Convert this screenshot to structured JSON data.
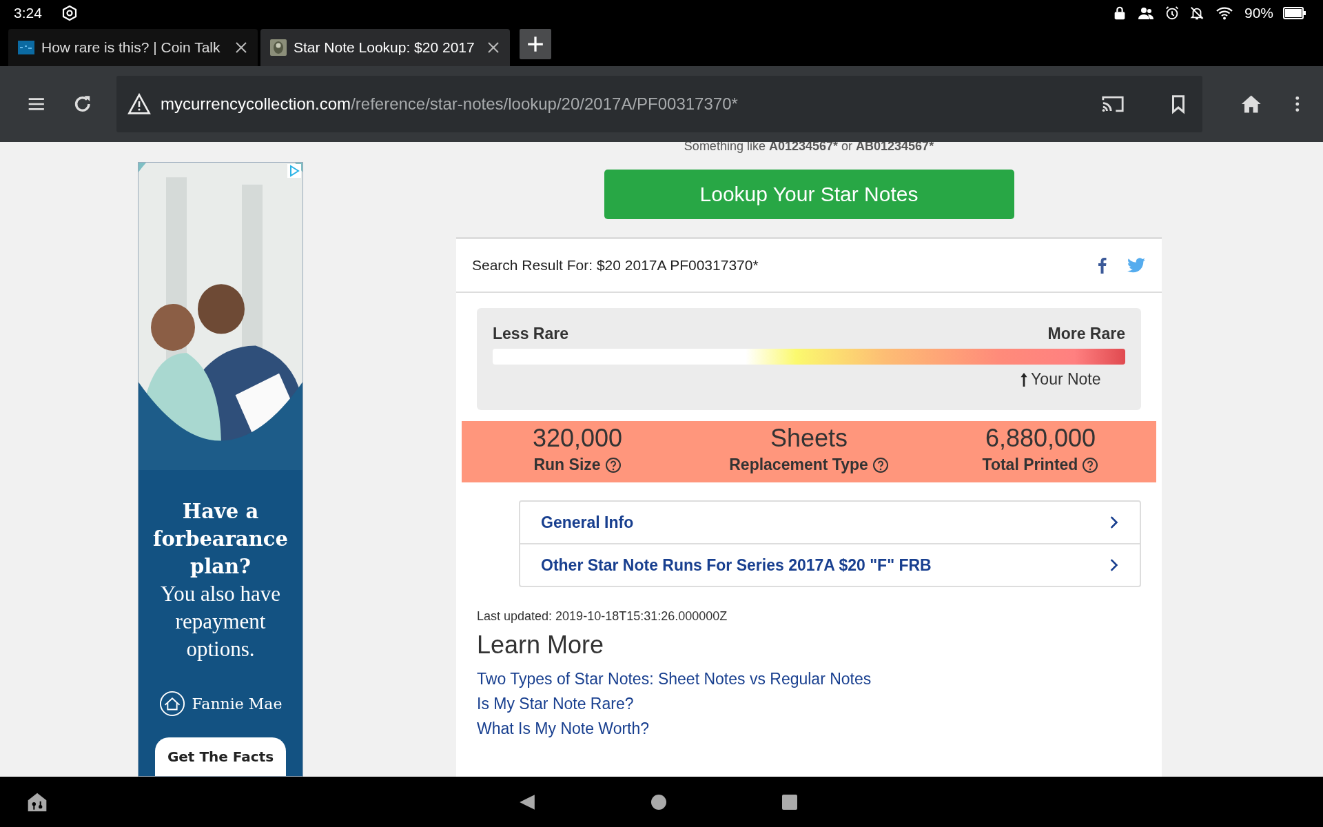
{
  "status_bar": {
    "time": "3:24",
    "battery": "90%"
  },
  "tabs": [
    {
      "title": "How rare is this? | Coin Talk",
      "selected": false
    },
    {
      "title": "Star Note Lookup: $20 2017",
      "selected": true
    }
  ],
  "address_bar": {
    "host": "mycurrencycollection.com",
    "path": "/reference/star-notes/lookup/20/2017A/PF00317370*"
  },
  "ad": {
    "headline": "Have a forbearance plan?",
    "body": "You also have repayment options.",
    "brand": "Fannie Mae",
    "button": "Get The Facts"
  },
  "search_hint": [
    {
      "text": "Something like ",
      "bold": false
    },
    {
      "text": "A01234567*",
      "bold": true
    },
    {
      "text": " or ",
      "bold": false
    },
    {
      "text": "AB01234567*",
      "bold": true
    }
  ],
  "lookup_button": "Lookup Your Star Notes",
  "result": {
    "title": "Search Result For: $20 2017A PF00317370*"
  },
  "rarity": {
    "low_label": "Less Rare",
    "high_label": "More Rare",
    "marker": "Your Note",
    "level": 0.84
  },
  "stats": [
    {
      "value": "320,000",
      "label": "Run Size"
    },
    {
      "value": "Sheets",
      "label": "Replacement Type"
    },
    {
      "value": "6,880,000",
      "label": "Total Printed"
    }
  ],
  "accordion": [
    {
      "title": "General Info",
      "expanded": false
    },
    {
      "title": "Other Star Note Runs For Series 2017A $20 \"F\" FRB",
      "expanded": false
    }
  ],
  "last_updated": "Last updated: 2019-10-18T15:31:26.000000Z",
  "learn_more": {
    "heading": "Learn More",
    "links": [
      "Two Types of Star Notes: Sheet Notes vs Regular Notes",
      "Is My Star Note Rare?",
      "What Is My Note Worth?"
    ]
  }
}
